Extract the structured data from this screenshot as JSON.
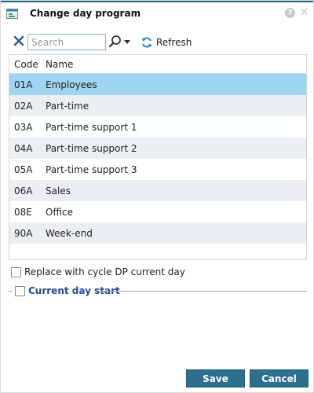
{
  "window": {
    "title": "Change day program",
    "icons": [
      "app-icon",
      "help-icon",
      "close-icon"
    ]
  },
  "toolbar": {
    "search_placeholder": "Search",
    "refresh_label": "Refresh",
    "icons": [
      "clear-search-icon",
      "search-icon",
      "dropdown-arrow-icon",
      "refresh-icon"
    ]
  },
  "table": {
    "columns": [
      "Code",
      "Name"
    ],
    "rows": [
      {
        "code": "01A",
        "name": "Employees",
        "selected": true
      },
      {
        "code": "02A",
        "name": "Part-time"
      },
      {
        "code": "03A",
        "name": "Part-time support 1"
      },
      {
        "code": "04A",
        "name": "Part-time support 2"
      },
      {
        "code": "05A",
        "name": "Part-time support 3"
      },
      {
        "code": "06A",
        "name": "Sales"
      },
      {
        "code": "08E",
        "name": "Office"
      },
      {
        "code": "90A",
        "name": "Week-end"
      }
    ]
  },
  "options": {
    "replace_label": "Replace with cycle DP current day",
    "current_day_start_label": "Current day start"
  },
  "buttons": {
    "save": "Save",
    "cancel": "Cancel"
  },
  "colors": {
    "accent": "#2d6f8f",
    "selected_row": "#9fd4f3",
    "alt_row": "#eceff1",
    "section_label": "#214a87"
  }
}
